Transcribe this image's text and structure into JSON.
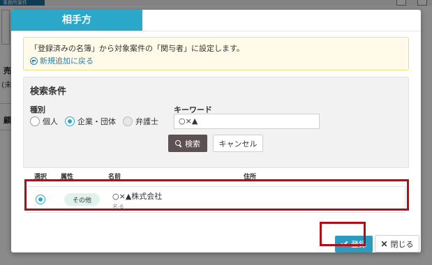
{
  "background": {
    "top_tab": "事務所案件",
    "label_a": "売",
    "label_b": "(未",
    "label_c": "顧"
  },
  "modal": {
    "title": "相手方",
    "notice": {
      "text": "「登録済みの名簿」から対象案件の「関与者」に設定します。",
      "back_link": "新規追加に戻る"
    },
    "search": {
      "title": "検索条件",
      "kind_label": "種別",
      "options": [
        "個人",
        "企業・団体",
        "弁護士"
      ],
      "selected": "企業・団体",
      "keyword_label": "キーワード",
      "keyword_value": "○×▲",
      "search_button": "検索",
      "cancel_button": "キャンセル"
    },
    "results": {
      "columns": [
        "選択",
        "属性",
        "名前",
        "住所"
      ],
      "rows": [
        {
          "badge": "その他",
          "name": "○×▲株式会社",
          "kana": "名-6",
          "address": ""
        }
      ]
    },
    "footer": {
      "register_button": "登録",
      "close_button": "閉じる"
    }
  },
  "colors": {
    "accent": "#2aa7c9",
    "highlight": "#b20d14",
    "search_button": "#5c5052"
  }
}
